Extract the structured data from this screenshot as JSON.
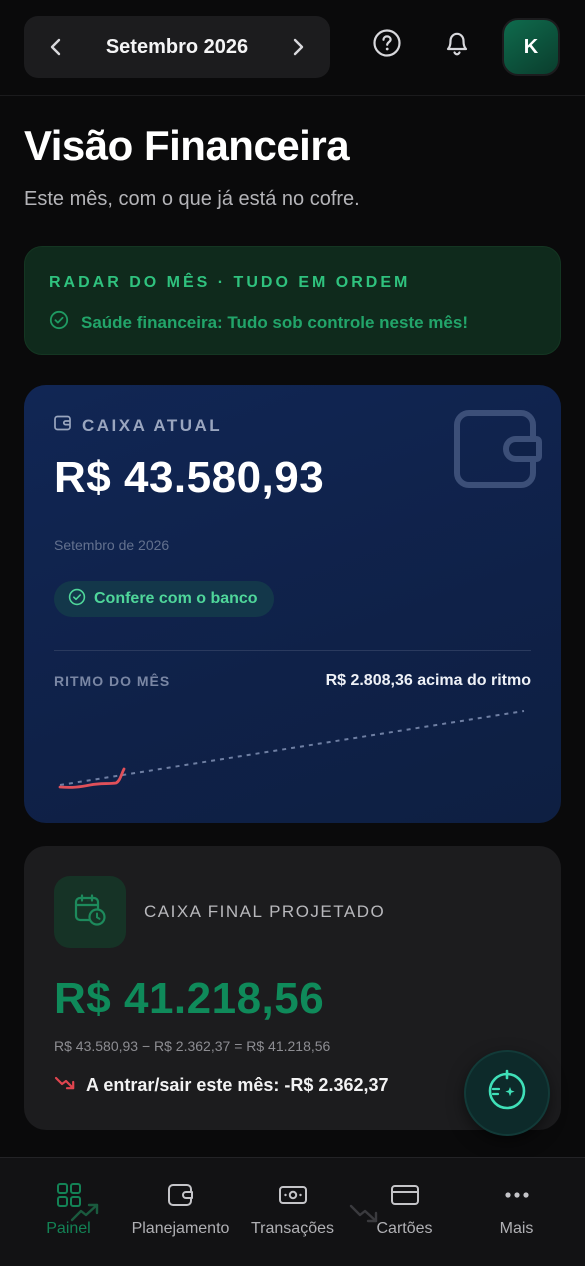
{
  "header": {
    "month_label": "Setembro 2026",
    "avatar_initial": "K"
  },
  "page": {
    "title": "Visão Financeira",
    "subtitle": "Este mês, com o que já está no cofre."
  },
  "radar": {
    "heading": "RADAR DO MÊS · TUDO EM ORDEM",
    "health_text": "Saúde financeira: Tudo sob controle neste mês!"
  },
  "cash": {
    "title": "CAIXA ATUAL",
    "amount": "R$ 43.580,93",
    "period": "Setembro de 2026",
    "bank_status": "Confere com o banco",
    "rhythm_label": "RITMO DO MÊS",
    "rhythm_value": "R$ 2.808,36 acima do ritmo"
  },
  "projected": {
    "title": "CAIXA FINAL PROJETADO",
    "amount": "R$ 41.218,56",
    "calc": "R$ 43.580,93 − R$ 2.362,37 = R$ 41.218,56",
    "flow": "A entrar/sair este mês: -R$ 2.362,37"
  },
  "nav": {
    "items": [
      {
        "label": "Painel",
        "icon": "grid-icon",
        "active": true
      },
      {
        "label": "Planejamento",
        "icon": "wallet-icon",
        "active": false
      },
      {
        "label": "Transações",
        "icon": "banknote-icon",
        "active": false
      },
      {
        "label": "Cartões",
        "icon": "card-icon",
        "active": false
      },
      {
        "label": "Mais",
        "icon": "more-icon",
        "active": false
      }
    ]
  },
  "colors": {
    "accent_green": "#2fc27e",
    "projected_green": "#0f8a5a",
    "spark_red": "#e0505a",
    "card_blue": "#112654"
  }
}
